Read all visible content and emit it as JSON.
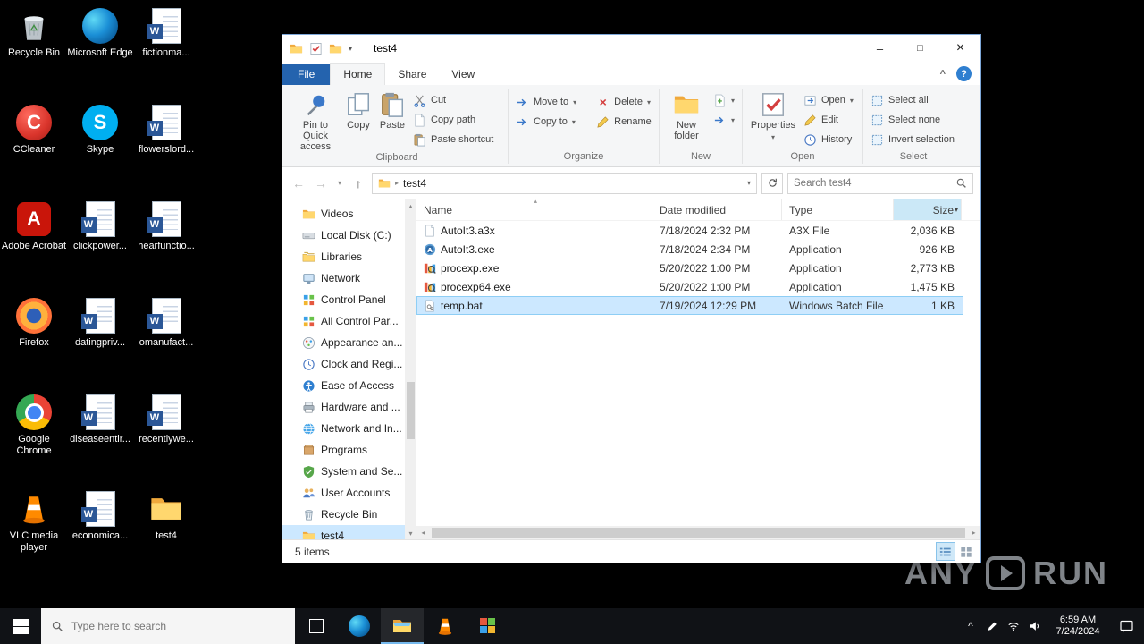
{
  "desktop": {
    "icons": [
      {
        "label": "Recycle Bin"
      },
      {
        "label": "Microsoft Edge"
      },
      {
        "label": "fictionma..."
      },
      {
        "label": "CCleaner"
      },
      {
        "label": "Skype"
      },
      {
        "label": "flowerslord..."
      },
      {
        "label": "Adobe Acrobat"
      },
      {
        "label": "clickpower..."
      },
      {
        "label": "hearfunctio..."
      },
      {
        "label": "Firefox"
      },
      {
        "label": "datingpriv..."
      },
      {
        "label": "omanufact..."
      },
      {
        "label": "Google Chrome"
      },
      {
        "label": "diseaseentir..."
      },
      {
        "label": "recentlywe..."
      },
      {
        "label": "VLC media player"
      },
      {
        "label": "economica..."
      },
      {
        "label": "test4"
      }
    ]
  },
  "explorer": {
    "window_title": "test4",
    "tabs": {
      "file": "File",
      "home": "Home",
      "share": "Share",
      "view": "View"
    },
    "ribbon": {
      "pin_to_quick_access": "Pin to Quick access",
      "copy": "Copy",
      "paste": "Paste",
      "cut": "Cut",
      "copy_path": "Copy path",
      "paste_shortcut": "Paste shortcut",
      "move_to": "Move to",
      "copy_to": "Copy to",
      "delete": "Delete",
      "rename": "Rename",
      "new_folder": "New folder",
      "properties": "Properties",
      "open": "Open",
      "edit": "Edit",
      "history": "History",
      "select_all": "Select all",
      "select_none": "Select none",
      "invert_selection": "Invert selection",
      "groups": {
        "clipboard": "Clipboard",
        "organize": "Organize",
        "new": "New",
        "open": "Open",
        "select": "Select"
      }
    },
    "address": {
      "path": "test4",
      "search_placeholder": "Search test4"
    },
    "sidebar": {
      "items": [
        {
          "label": "Videos"
        },
        {
          "label": "Local Disk (C:)"
        },
        {
          "label": "Libraries"
        },
        {
          "label": "Network"
        },
        {
          "label": "Control Panel"
        },
        {
          "label": "All Control Par..."
        },
        {
          "label": "Appearance an..."
        },
        {
          "label": "Clock and Regi..."
        },
        {
          "label": "Ease of Access"
        },
        {
          "label": "Hardware and ..."
        },
        {
          "label": "Network and In..."
        },
        {
          "label": "Programs"
        },
        {
          "label": "System and Se..."
        },
        {
          "label": "User Accounts"
        },
        {
          "label": "Recycle Bin"
        },
        {
          "label": "test4"
        }
      ]
    },
    "list": {
      "columns": [
        "Name",
        "Date modified",
        "Type",
        "Size"
      ],
      "files": [
        {
          "name": "AutoIt3.a3x",
          "modified": "7/18/2024 2:32 PM",
          "type": "A3X File",
          "size": "2,036 KB"
        },
        {
          "name": "AutoIt3.exe",
          "modified": "7/18/2024 2:34 PM",
          "type": "Application",
          "size": "926 KB"
        },
        {
          "name": "procexp.exe",
          "modified": "5/20/2022 1:00 PM",
          "type": "Application",
          "size": "2,773 KB"
        },
        {
          "name": "procexp64.exe",
          "modified": "5/20/2022 1:00 PM",
          "type": "Application",
          "size": "1,475 KB"
        },
        {
          "name": "temp.bat",
          "modified": "7/19/2024 12:29 PM",
          "type": "Windows Batch File",
          "size": "1 KB"
        }
      ]
    },
    "status_text": "5 items"
  },
  "taskbar": {
    "search_placeholder": "Type here to search",
    "time": "6:59 AM",
    "date": "7/24/2024"
  },
  "watermark": {
    "any": "ANY",
    "run": "RUN"
  }
}
